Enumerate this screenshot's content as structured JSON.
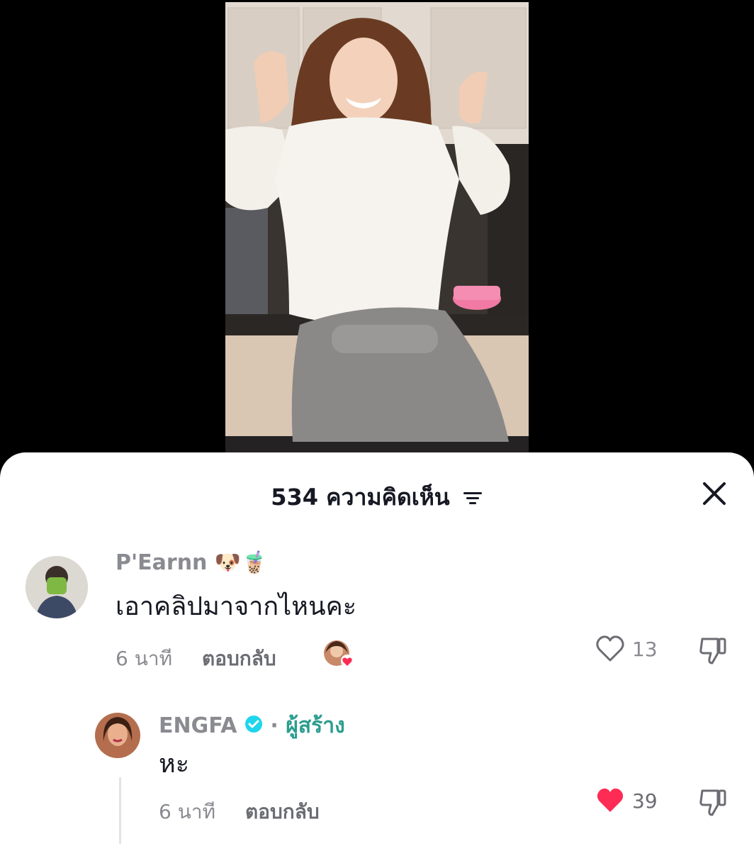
{
  "header": {
    "comment_count": "534",
    "title_label": "ความคิดเห็น"
  },
  "comments": [
    {
      "username": "P'Earnn",
      "emoji": "🐶🧋",
      "text": "เอาคลิปมาจากไหนคะ",
      "time": "6 นาที",
      "reply_label": "ตอบกลับ",
      "likes": "13",
      "liked": false
    },
    {
      "username": "ENGFA",
      "verified": true,
      "separator": "·",
      "creator_label": "ผู้สร้าง",
      "text": "หะ",
      "time": "6 นาที",
      "reply_label": "ตอบกลับ",
      "likes": "39",
      "liked": true
    }
  ],
  "colors": {
    "like_active": "#fe2c55",
    "verified": "#20d5ec",
    "creator": "#2a9d8f"
  },
  "icons": [
    "filter-icon",
    "close-icon",
    "heart-icon",
    "dislike-icon",
    "verified-icon",
    "creator-liked-avatar"
  ]
}
